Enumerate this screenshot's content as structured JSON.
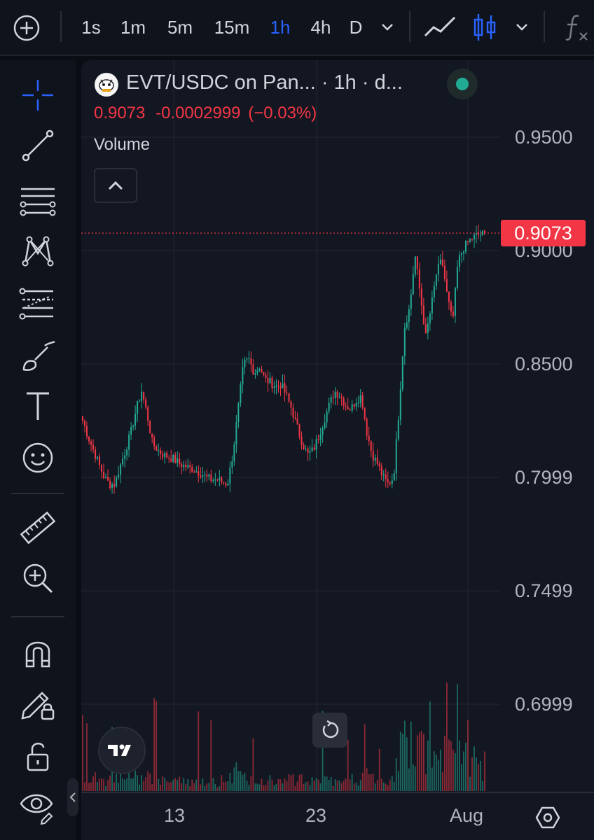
{
  "toolbar": {
    "intervals": [
      "1s",
      "1m",
      "5m",
      "15m",
      "1h",
      "4h",
      "D"
    ],
    "active_interval": "1h"
  },
  "left_tools": [
    "crosshair-icon",
    "trend-line-icon",
    "horizontal-lines-icon",
    "pattern-icon",
    "fib-retracement-icon",
    "brush-icon",
    "text-icon",
    "emoji-icon",
    "ruler-icon",
    "zoom-in-icon",
    "magnet-icon",
    "lock-drawing-icon",
    "unlock-icon",
    "eye-icon"
  ],
  "legend": {
    "title": "EVT/USDC on Pan... · 1h · d...",
    "last": "0.9073",
    "change": "-0.0002999",
    "change_pct": "(−0.03%)",
    "volume_label": "Volume"
  },
  "price_axis": {
    "labels": [
      "0.9500",
      "0.9000",
      "0.8500",
      "0.7999",
      "0.7499",
      "0.6999"
    ],
    "last_price_tag": "0.9073"
  },
  "time_axis": {
    "labels": [
      "13",
      "23",
      "Aug"
    ]
  },
  "colors": {
    "up": "#22ab94",
    "down": "#f23645",
    "active_interval": "#2962ff",
    "background": "#131722"
  },
  "chart_data": {
    "type": "candlestick",
    "symbol": "EVT/USDC",
    "interval": "1h",
    "y_range": [
      0.67,
      0.97
    ],
    "close_series_approx": [
      0.825,
      0.818,
      0.812,
      0.806,
      0.8,
      0.797,
      0.797,
      0.805,
      0.812,
      0.82,
      0.83,
      0.838,
      0.828,
      0.815,
      0.812,
      0.81,
      0.809,
      0.808,
      0.806,
      0.805,
      0.804,
      0.803,
      0.802,
      0.8,
      0.799,
      0.799,
      0.798,
      0.797,
      0.81,
      0.83,
      0.85,
      0.852,
      0.846,
      0.849,
      0.843,
      0.842,
      0.84,
      0.841,
      0.836,
      0.83,
      0.822,
      0.815,
      0.81,
      0.812,
      0.818,
      0.825,
      0.832,
      0.838,
      0.836,
      0.832,
      0.83,
      0.834,
      0.836,
      0.82,
      0.81,
      0.806,
      0.8,
      0.797,
      0.8,
      0.83,
      0.866,
      0.875,
      0.898,
      0.88,
      0.862,
      0.875,
      0.89,
      0.896,
      0.88,
      0.868,
      0.895,
      0.901,
      0.904,
      0.906,
      0.907,
      0.9073
    ]
  }
}
